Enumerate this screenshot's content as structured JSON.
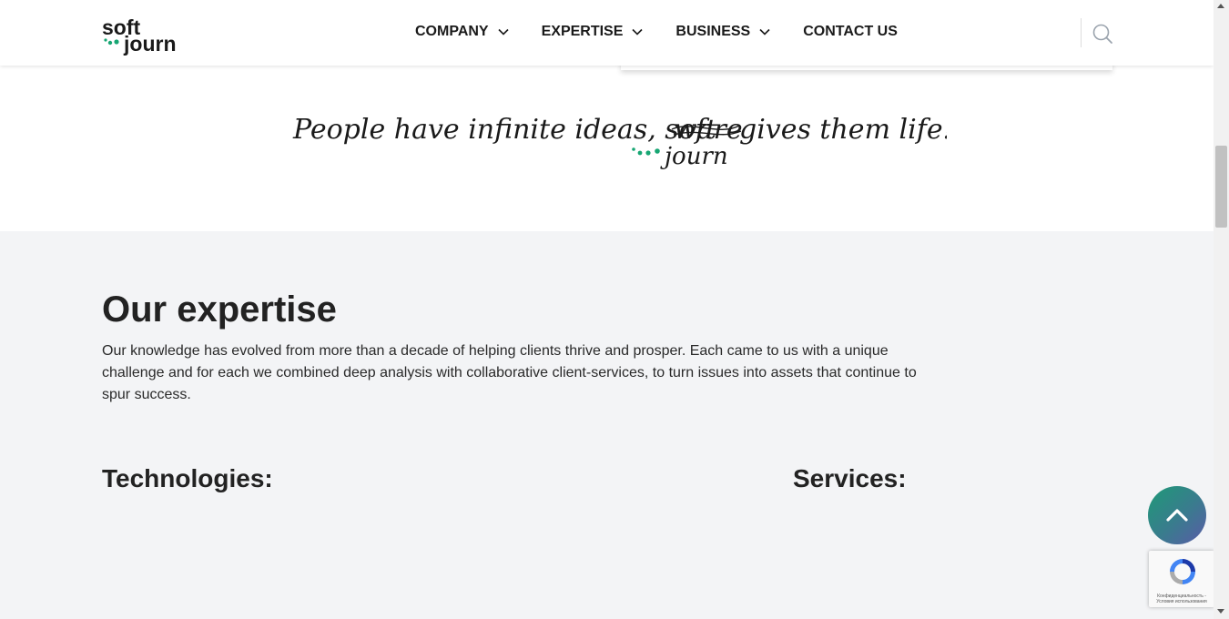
{
  "brand": {
    "logo_top": "soft",
    "logo_bottom": "journ",
    "accent_color": "#17a673",
    "dark_color": "#1a1a1a"
  },
  "nav": {
    "items": [
      {
        "label": "COMPANY",
        "has_dropdown": true
      },
      {
        "label": "EXPERTISE",
        "has_dropdown": true
      },
      {
        "label": "BUSINESS",
        "has_dropdown": true
      },
      {
        "label": "CONTACT US",
        "has_dropdown": false
      }
    ],
    "search_icon": "search-icon"
  },
  "tagline": {
    "before": "People have infinite ideas, soft",
    "struck": "ware",
    "after": "gives them life!",
    "insert": "journ"
  },
  "expertise": {
    "title": "Our expertise",
    "text": "Our knowledge has evolved from more than a decade of helping clients thrive and prosper. Each came to us with a unique challenge and for each we combined deep analysis with collaborative client-services, to turn issues into assets that continue to spur success.",
    "technologies_title": "Technologies:",
    "services_title": "Services:"
  },
  "scroll_top": {
    "icon": "chevron-up-icon"
  },
  "recaptcha": {
    "icon": "recaptcha-icon",
    "text": "Конфиденциальность - Условия использования"
  }
}
